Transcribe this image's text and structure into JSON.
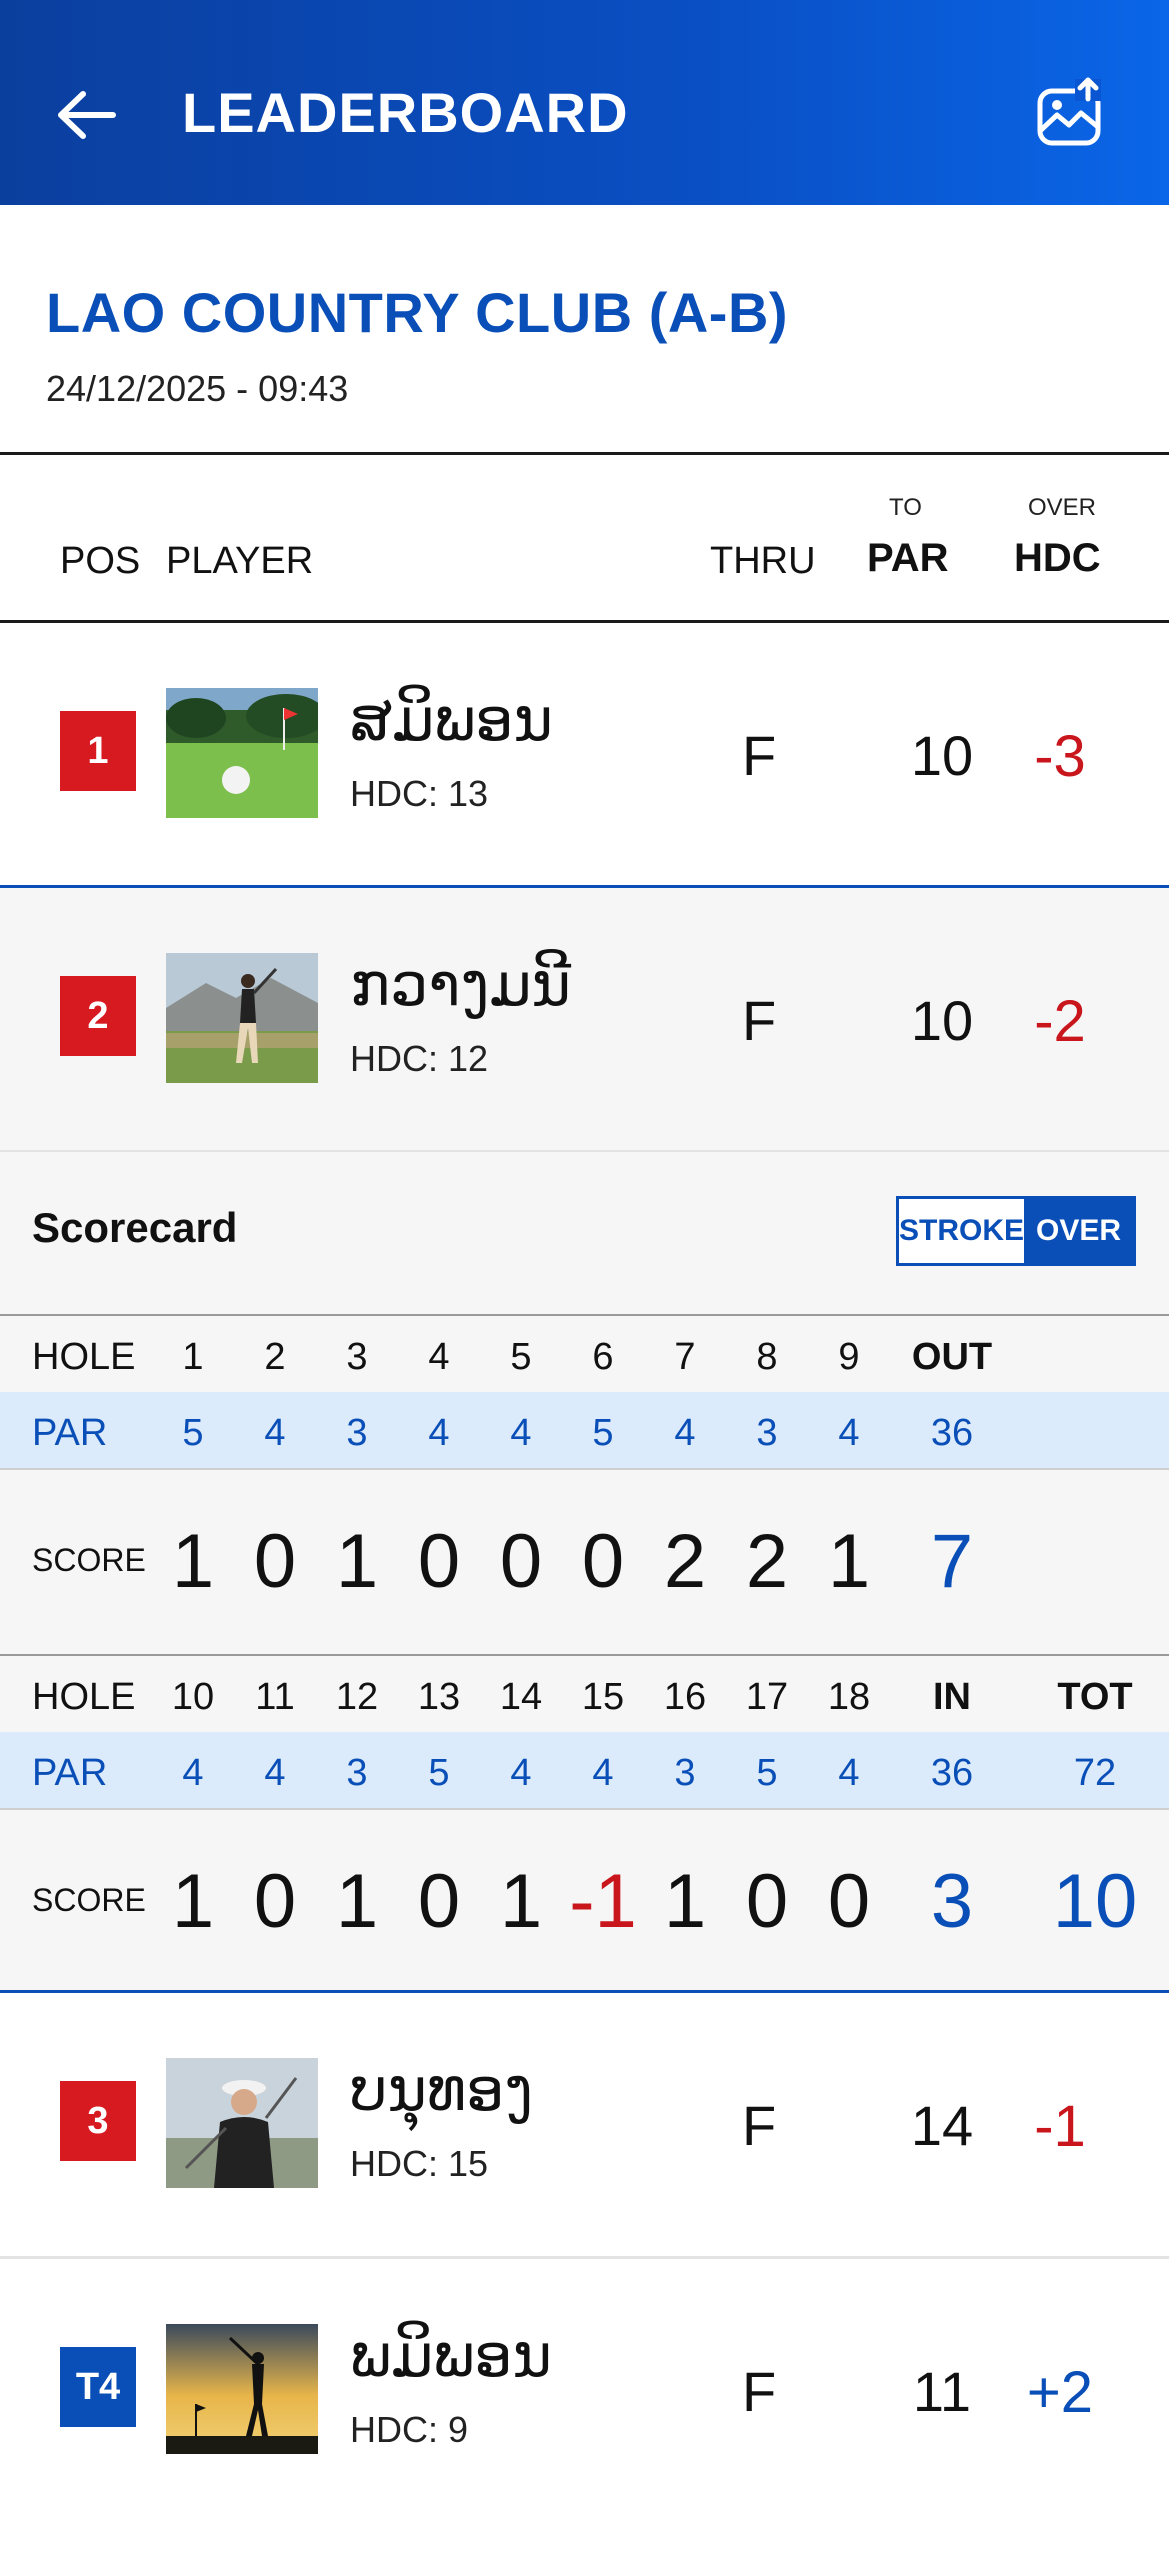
{
  "appbar": {
    "title": "LEADERBOARD",
    "back_icon": "arrow-left-icon",
    "share_icon": "image-upload-icon"
  },
  "course": {
    "name": "LAO COUNTRY CLUB (A-B)",
    "datetime": "24/12/2025 - 09:43"
  },
  "table_header": {
    "pos": "POS",
    "player": "PLAYER",
    "thru": "THRU",
    "to_small": "TO",
    "par": "PAR",
    "over_small": "OVER",
    "hdc": "HDC"
  },
  "players": [
    {
      "pos": "1",
      "name": "ສມິພອນ",
      "hdc": "HDC: 13",
      "thru": "F",
      "to_par": "10",
      "over_hdc": "-3",
      "pos_color": "red",
      "over_color": "neg",
      "photo": "golf-ball-photo"
    },
    {
      "pos": "2",
      "name": "ກວາງມນີ",
      "hdc": "HDC: 12",
      "thru": "F",
      "to_par": "10",
      "over_hdc": "-2",
      "pos_color": "red",
      "over_color": "neg",
      "photo": "golfer-swing-photo"
    },
    {
      "pos": "3",
      "name": "ບນຸທອງ",
      "hdc": "HDC: 15",
      "thru": "F",
      "to_par": "14",
      "over_hdc": "-1",
      "pos_color": "red",
      "over_color": "neg",
      "photo": "golfer-hat-photo"
    },
    {
      "pos": "T4",
      "name": "ພມິພອນ",
      "hdc": "HDC: 9",
      "thru": "F",
      "to_par": "11",
      "over_hdc": "+2",
      "pos_color": "blue",
      "over_color": "pos",
      "photo": "golfer-sunset-photo"
    }
  ],
  "scorecard": {
    "title": "Scorecard",
    "toggle": {
      "stroke": "STROKE",
      "over": "OVER"
    },
    "labels": {
      "hole": "HOLE",
      "par": "PAR",
      "score": "SCORE"
    },
    "front": {
      "holes": [
        "1",
        "2",
        "3",
        "4",
        "5",
        "6",
        "7",
        "8",
        "9"
      ],
      "sum_label": "OUT",
      "par": [
        "5",
        "4",
        "3",
        "4",
        "4",
        "5",
        "4",
        "3",
        "4"
      ],
      "par_sum": "36",
      "score": [
        "1",
        "0",
        "1",
        "0",
        "0",
        "0",
        "2",
        "2",
        "1"
      ],
      "score_sum": "7"
    },
    "back": {
      "holes": [
        "10",
        "11",
        "12",
        "13",
        "14",
        "15",
        "16",
        "17",
        "18"
      ],
      "sum_label": "IN",
      "tot_label": "TOT",
      "par": [
        "4",
        "4",
        "3",
        "5",
        "4",
        "4",
        "3",
        "5",
        "4"
      ],
      "par_sum": "36",
      "par_tot": "72",
      "score": [
        "1",
        "0",
        "1",
        "0",
        "1",
        "-1",
        "1",
        "0",
        "0"
      ],
      "score_sum": "3",
      "score_tot": "10"
    }
  },
  "colors": {
    "header_blue": "#0a4fc4",
    "accent_blue": "#0a4fb8",
    "red": "#d71920",
    "par_row_bg": "#dcebfb"
  }
}
